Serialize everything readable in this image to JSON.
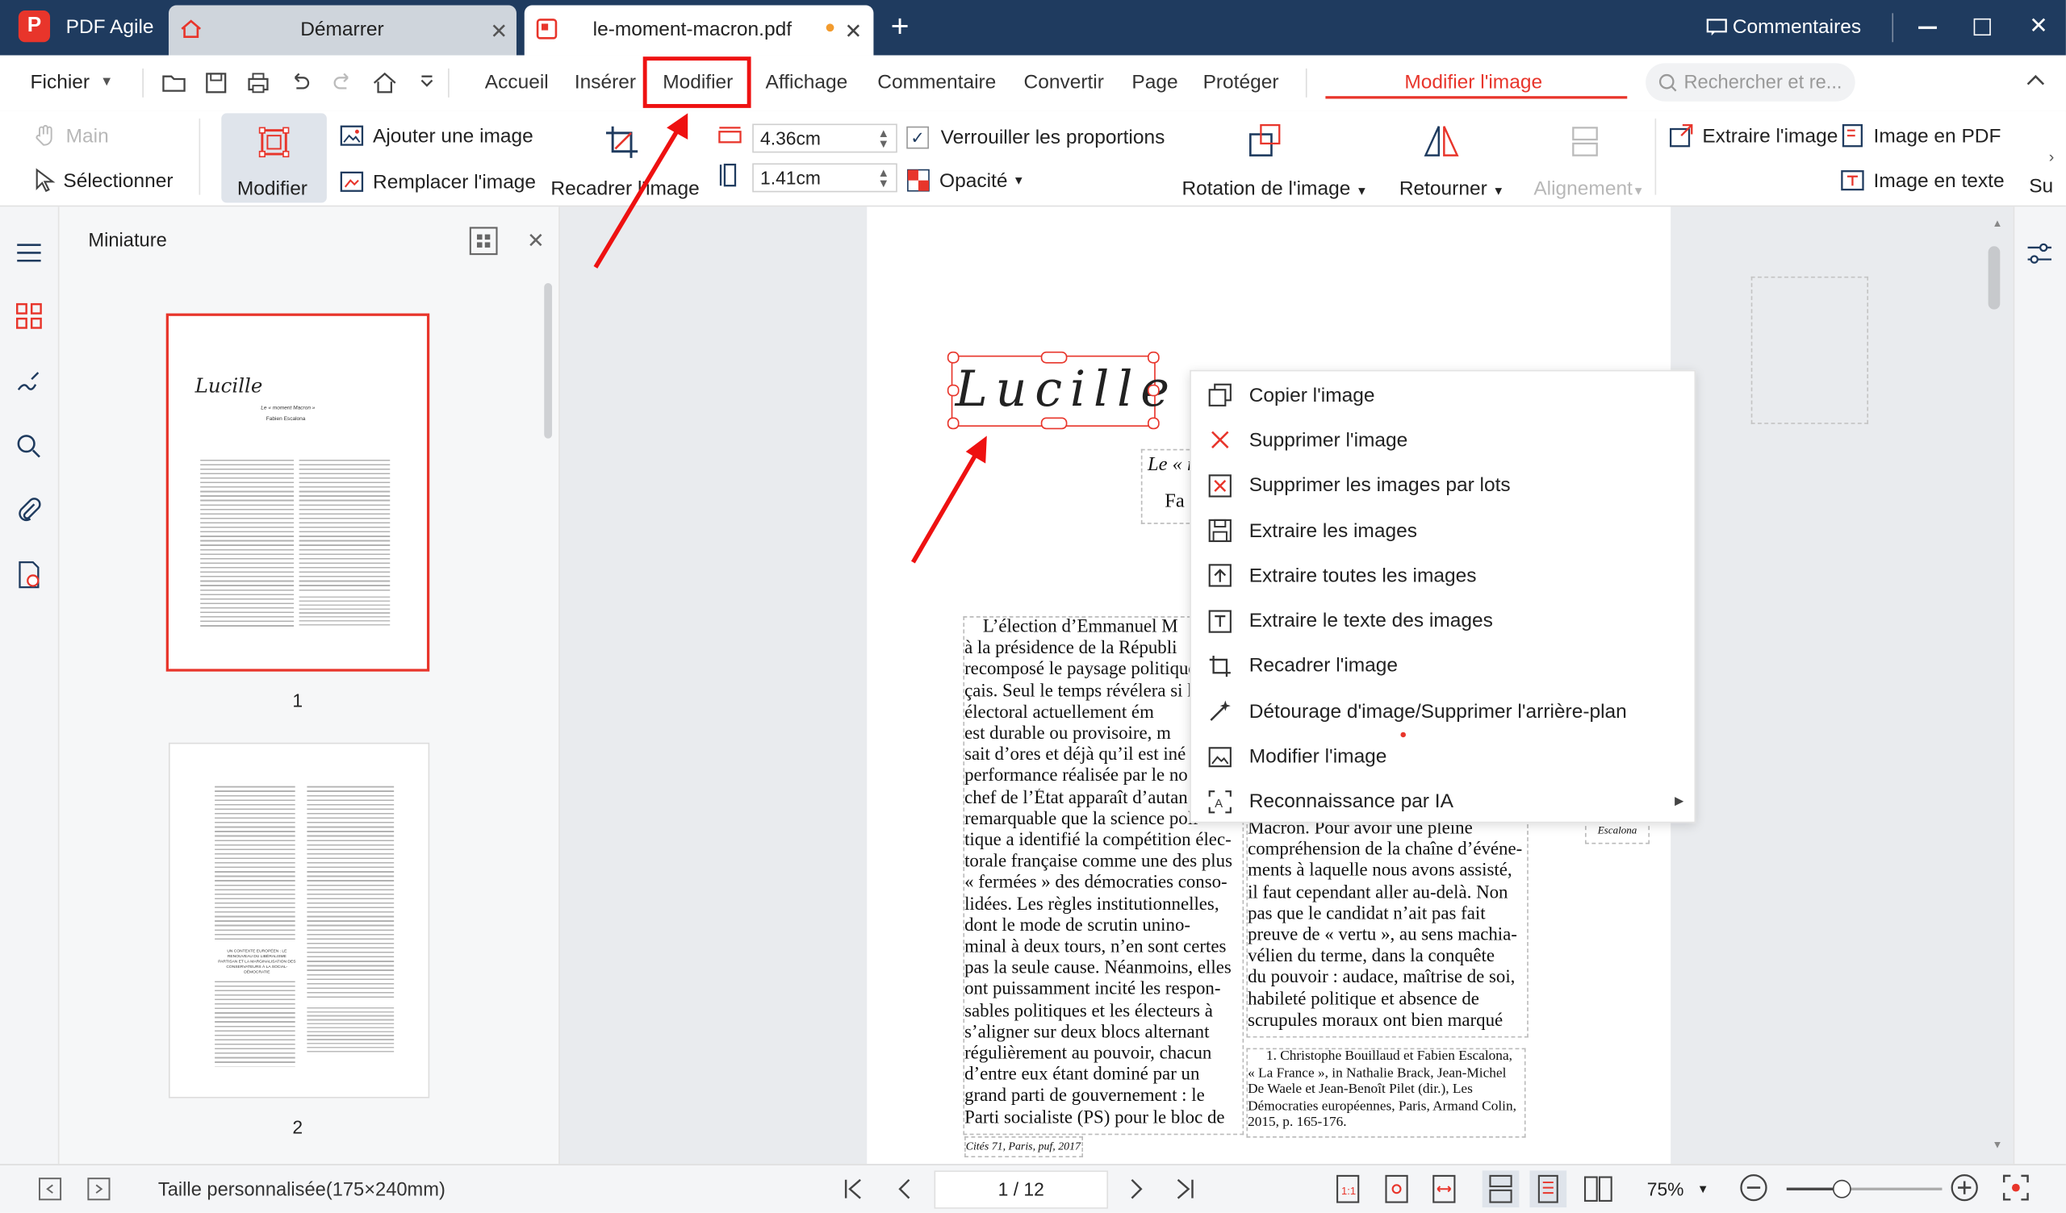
{
  "app": {
    "name": "PDF Agile",
    "logo_letter": "P"
  },
  "tabs": [
    {
      "label": "Démarrer"
    },
    {
      "label": "le-moment-macron.pdf"
    }
  ],
  "titlebar": {
    "comments_label": "Commentaires"
  },
  "menu": {
    "file": "Fichier",
    "items": [
      "Accueil",
      "Insérer",
      "Modifier",
      "Affichage",
      "Commentaire",
      "Convertir",
      "Page",
      "Protéger"
    ],
    "context_tab": "Modifier l'image",
    "search_placeholder": "Rechercher et re..."
  },
  "ribbon": {
    "hand": "Main",
    "select": "Sélectionner",
    "modify": "Modifier",
    "add_image": "Ajouter une image",
    "replace_image": "Remplacer l'image",
    "crop_image": "Recadrer l'image",
    "width_value": "4.36cm",
    "height_value": "1.41cm",
    "lock_ratio": "Verrouiller les proportions",
    "opacity": "Opacité",
    "rotate": "Rotation de l'image",
    "flip": "Retourner",
    "align": "Alignement",
    "extract_image": "Extraire l'image",
    "image_to_pdf": "Image en PDF",
    "image_to_text": "Image en texte",
    "overflow": "Su"
  },
  "thumbnails": {
    "title": "Miniature",
    "pages": [
      {
        "number": "1",
        "heading": "Lucille",
        "subtitle": "Le « moment Macron »",
        "author": "Fabien Escalona"
      },
      {
        "number": "2",
        "section": "UN CONTEXTE EUROPÉEN : LE RENOUVEAU DU LIBÉRALISME PARTISAN ET LA MARGINALISATION DES CONSERVATEURS À LA SOCIAL-DÉMOCRATIE"
      }
    ]
  },
  "document": {
    "signature": "Lucille",
    "subtitle_fragment": "Le « r",
    "author_fragment": "Fa",
    "col1": [
      "L’élection d’Emmanuel M",
      "à la présidence de la Républi",
      "recomposé le paysage politique",
      "çais. Seul le temps révélera si l",
      "électoral actuellement ém",
      "est durable ou provisoire, m",
      "sait d’ores et déjà qu’il est iné",
      "performance réalisée par le no",
      "chef de l’État apparaît d’autan",
      "remarquable que la science poli-",
      "tique a identifié la compétition élec-",
      "torale française comme une des plus",
      "« fermées » des démocraties conso-",
      "lidées. Les règles institutionnelles,",
      "dont le mode de scrutin unino-",
      "minal à deux tours, n’en sont certes",
      "pas la seule cause. Néanmoins, elles",
      "ont puissamment incité les respon-",
      "sables politiques et les électeurs à",
      "s’aligner sur deux blocs alternant",
      "régulièrement au pouvoir, chacun",
      "d’entre eux étant dominé par un",
      "grand parti de gouvernement : le",
      "Parti socialiste (PS) pour le bloc de"
    ],
    "col2": [
      "Macron. Pour avoir une pleine",
      "compréhension de la chaîne d’événe-",
      "ments à laquelle nous avons assisté,",
      "il faut cependant aller au-delà. Non",
      "pas que le candidat n’ait pas fait",
      "preuve de « vertu », au sens machia-",
      "vélien du terme, dans la conquête",
      "du pouvoir : audace, maîtrise de soi,",
      "habileté politique et absence de",
      "scrupules moraux ont bien marqué"
    ],
    "footnote": [
      "1. Christophe Bouillaud et Fabien Escalona,",
      "« La France », in Nathalie Brack, Jean-Michel",
      "De Waele et Jean-Benoît Pilet (dir.), Les",
      "Démocraties européennes, Paris, Armand Colin,",
      "2015, p. 165-176."
    ],
    "running_foot": "Cités 71, Paris, puf, 2017",
    "margin_note": "Escalona"
  },
  "context_menu": [
    {
      "label": "Copier l'image",
      "icon": "copy-icon"
    },
    {
      "label": "Supprimer l'image",
      "icon": "delete-x-icon"
    },
    {
      "label": "Supprimer les images par lots",
      "icon": "batch-delete-icon"
    },
    {
      "label": "Extraire les images",
      "icon": "save-icon"
    },
    {
      "label": "Extraire toutes les images",
      "icon": "export-icon"
    },
    {
      "label": "Extraire le texte des images",
      "icon": "text-extract-icon"
    },
    {
      "label": "Recadrer l'image",
      "icon": "crop-icon"
    },
    {
      "label": "Détourage d'image/Supprimer l'arrière-plan",
      "icon": "magic-wand-icon"
    },
    {
      "label": "Modifier l'image",
      "icon": "image-edit-icon"
    },
    {
      "label": "Reconnaissance par IA",
      "icon": "ai-scan-icon",
      "submenu": true
    }
  ],
  "status": {
    "page_size": "Taille personnalisée(175×240mm)",
    "page_indicator": "1 / 12",
    "zoom": "75%"
  },
  "colors": {
    "titlebar": "#1f3b5f",
    "accent_red": "#e8352b",
    "annotation_red": "#ee1111"
  }
}
